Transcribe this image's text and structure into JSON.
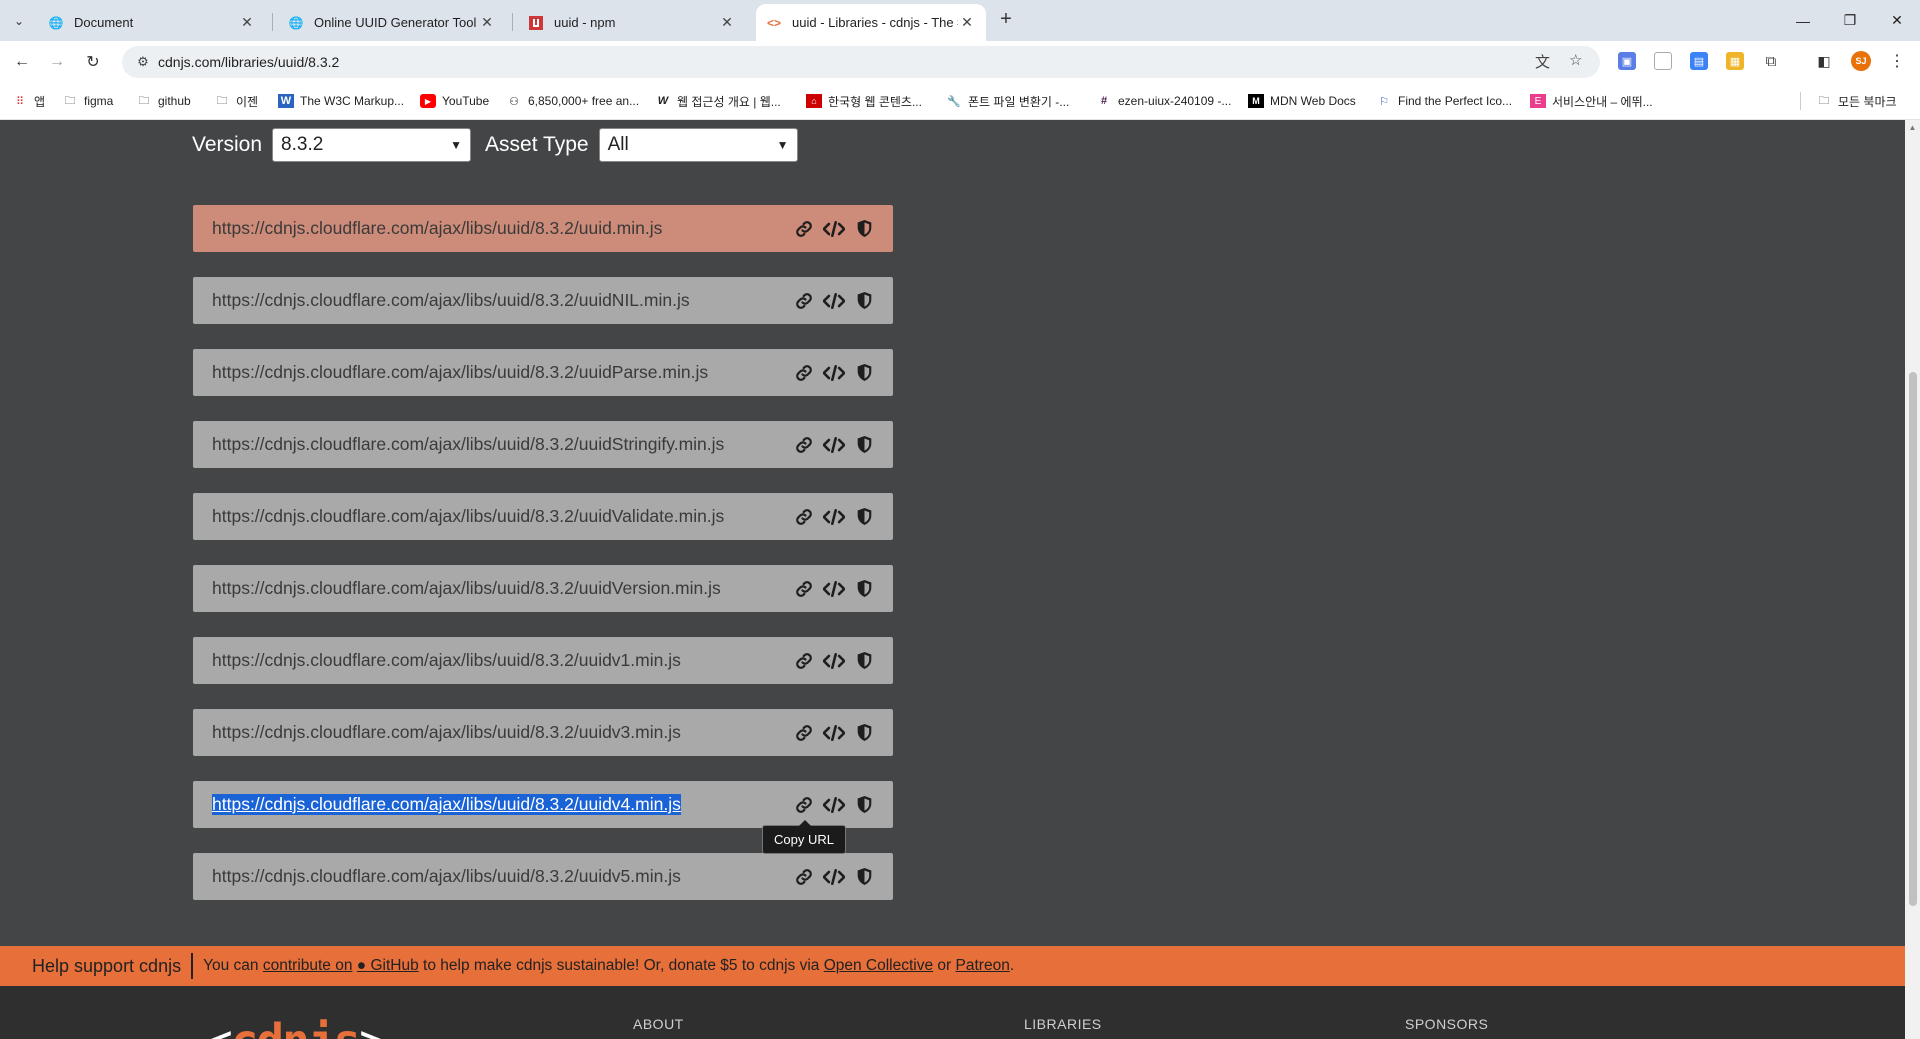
{
  "browser": {
    "tabs": [
      {
        "title": "Document",
        "icon": "globe-icon"
      },
      {
        "title": "Online UUID Generator Tool",
        "icon": "globe-icon"
      },
      {
        "title": "uuid - npm",
        "icon": "npm-icon"
      },
      {
        "title": "uuid - Libraries - cdnjs - The #",
        "icon": "code-icon",
        "active": true
      }
    ],
    "url": "cdnjs.com/libraries/uuid/8.3.2",
    "profile_initials": "SJ",
    "bookmarks": [
      {
        "label": "앱",
        "icon": "apps-grid-icon"
      },
      {
        "label": "figma",
        "icon": "folder-icon"
      },
      {
        "label": "github",
        "icon": "folder-icon"
      },
      {
        "label": "이젠",
        "icon": "folder-icon"
      },
      {
        "label": "The W3C Markup...",
        "icon": "w3c-icon"
      },
      {
        "label": "YouTube",
        "icon": "youtube-icon"
      },
      {
        "label": "6,850,000+ free an...",
        "icon": "flaticon-icon"
      },
      {
        "label": "웹 접근성 개요 | 웹...",
        "icon": "w-icon"
      },
      {
        "label": "한국형 웹 콘텐츠...",
        "icon": "pdf-icon"
      },
      {
        "label": "폰트 파일 변환기 -...",
        "icon": "wrench-icon"
      },
      {
        "label": "ezen-uiux-240109 -...",
        "icon": "slack-icon"
      },
      {
        "label": "MDN Web Docs",
        "icon": "mdn-icon"
      },
      {
        "label": "Find the Perfect Ico...",
        "icon": "flag-icon"
      },
      {
        "label": "서비스안내 – 에뛰...",
        "icon": "e-icon"
      }
    ],
    "all_bookmarks_label": "모든 북마크"
  },
  "filters": {
    "version_label": "Version",
    "version_value": "8.3.2",
    "asset_label": "Asset Type",
    "asset_value": "All"
  },
  "assets": [
    {
      "url": "https://cdnjs.cloudflare.com/ajax/libs/uuid/8.3.2/uuid.min.js",
      "highlighted": true
    },
    {
      "url": "https://cdnjs.cloudflare.com/ajax/libs/uuid/8.3.2/uuidNIL.min.js"
    },
    {
      "url": "https://cdnjs.cloudflare.com/ajax/libs/uuid/8.3.2/uuidParse.min.js"
    },
    {
      "url": "https://cdnjs.cloudflare.com/ajax/libs/uuid/8.3.2/uuidStringify.min.js"
    },
    {
      "url": "https://cdnjs.cloudflare.com/ajax/libs/uuid/8.3.2/uuidValidate.min.js"
    },
    {
      "url": "https://cdnjs.cloudflare.com/ajax/libs/uuid/8.3.2/uuidVersion.min.js"
    },
    {
      "url": "https://cdnjs.cloudflare.com/ajax/libs/uuid/8.3.2/uuidv1.min.js"
    },
    {
      "url": "https://cdnjs.cloudflare.com/ajax/libs/uuid/8.3.2/uuidv3.min.js"
    },
    {
      "url": "https://cdnjs.cloudflare.com/ajax/libs/uuid/8.3.2/uuidv4.min.js",
      "selected": true
    },
    {
      "url": "https://cdnjs.cloudflare.com/ajax/libs/uuid/8.3.2/uuidv5.min.js"
    }
  ],
  "tooltip": "Copy URL",
  "support": {
    "heading": "Help support cdnjs",
    "text_1": "You can ",
    "link_contribute": "contribute on",
    "link_github": "GitHub",
    "text_2": " to help make cdnjs sustainable! Or, donate $5 to cdnjs via ",
    "link_open_collective": "Open Collective",
    "text_3": " or ",
    "link_patreon": "Patreon",
    "text_4": "."
  },
  "footer": {
    "logo_open": "<",
    "logo_text": "cdnjs",
    "logo_close": ">",
    "columns": [
      "ABOUT",
      "LIBRARIES",
      "SPONSORS"
    ]
  },
  "colors": {
    "page_bg": "#444547",
    "row_bg": "#a9a9a9",
    "row_highlight": "#cd8b79",
    "accent": "#e76f3a",
    "selection": "#1a63d6"
  }
}
